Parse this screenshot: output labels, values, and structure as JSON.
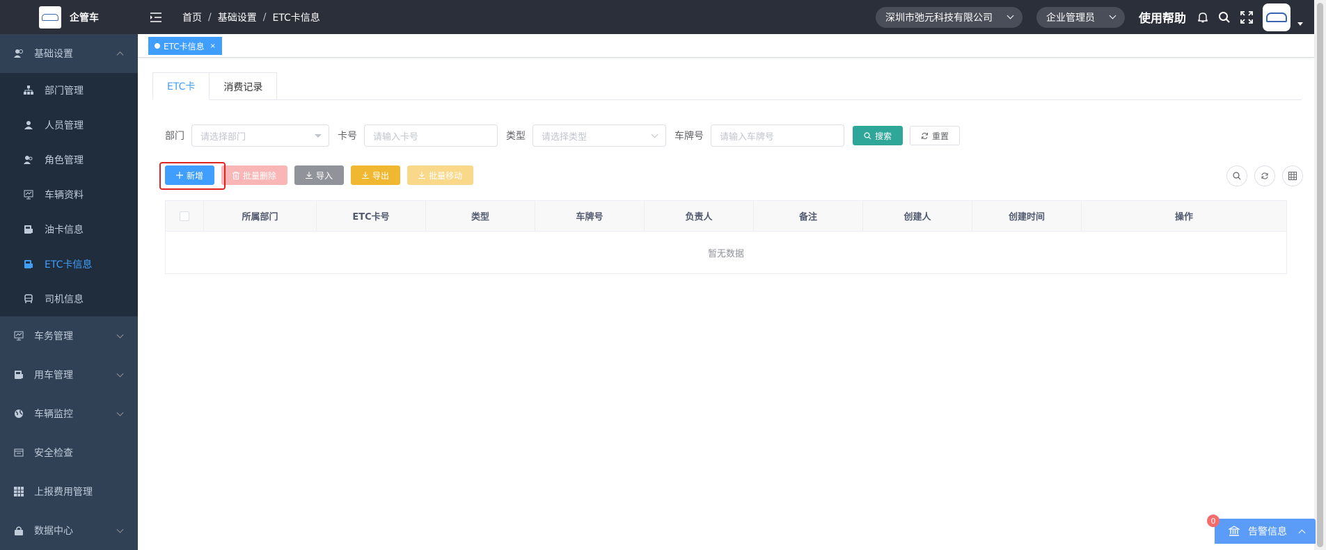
{
  "app": {
    "name": "企管车"
  },
  "sidebar": {
    "groups": [
      {
        "label": "基础设置",
        "icon": "users-icon",
        "expanded": true,
        "items": [
          {
            "label": "部门管理",
            "icon": "org-tree-icon"
          },
          {
            "label": "人员管理",
            "icon": "user-icon"
          },
          {
            "label": "角色管理",
            "icon": "role-icon"
          },
          {
            "label": "车辆资料",
            "icon": "monitor-icon"
          },
          {
            "label": "油卡信息",
            "icon": "card-icon"
          },
          {
            "label": "ETC卡信息",
            "icon": "card-icon",
            "active": true
          },
          {
            "label": "司机信息",
            "icon": "bus-icon"
          }
        ]
      },
      {
        "label": "车务管理",
        "icon": "monitor-icon"
      },
      {
        "label": "用车管理",
        "icon": "card-icon"
      },
      {
        "label": "车辆监控",
        "icon": "globe-icon"
      },
      {
        "label": "安全检查",
        "icon": "calendar-icon"
      },
      {
        "label": "上报费用管理",
        "icon": "grid-icon"
      },
      {
        "label": "数据中心",
        "icon": "lock-icon"
      }
    ]
  },
  "topbar": {
    "breadcrumb": [
      "首页",
      "基础设置",
      "ETC卡信息"
    ],
    "company": "深圳市弛元科技有限公司",
    "role": "企业管理员",
    "help": "使用帮助"
  },
  "tags": {
    "active": "ETC卡信息",
    "close": "×"
  },
  "tabs": [
    "ETC卡",
    "消费记录"
  ],
  "search": {
    "dept_label": "部门",
    "dept_placeholder": "请选择部门",
    "card_label": "卡号",
    "card_placeholder": "请输入卡号",
    "type_label": "类型",
    "type_placeholder": "请选择类型",
    "plate_label": "车牌号",
    "plate_placeholder": "请输入车牌号",
    "search_btn": "搜索",
    "reset_btn": "重置"
  },
  "toolbar": {
    "add": "新增",
    "batch_delete": "批量删除",
    "import": "导入",
    "export": "导出",
    "batch_move": "批量移动"
  },
  "table": {
    "columns": [
      "所属部门",
      "ETC卡号",
      "类型",
      "车牌号",
      "负责人",
      "备注",
      "创建人",
      "创建时间",
      "操作"
    ],
    "empty": "暂无数据"
  },
  "alarm": {
    "label": "告警信息",
    "count": "0"
  },
  "colors": {
    "sidebar_bg": "#304156",
    "topbar_bg": "#2b2f3a",
    "primary": "#409eff",
    "teal": "#2ea799",
    "highlight": "#e02424"
  }
}
